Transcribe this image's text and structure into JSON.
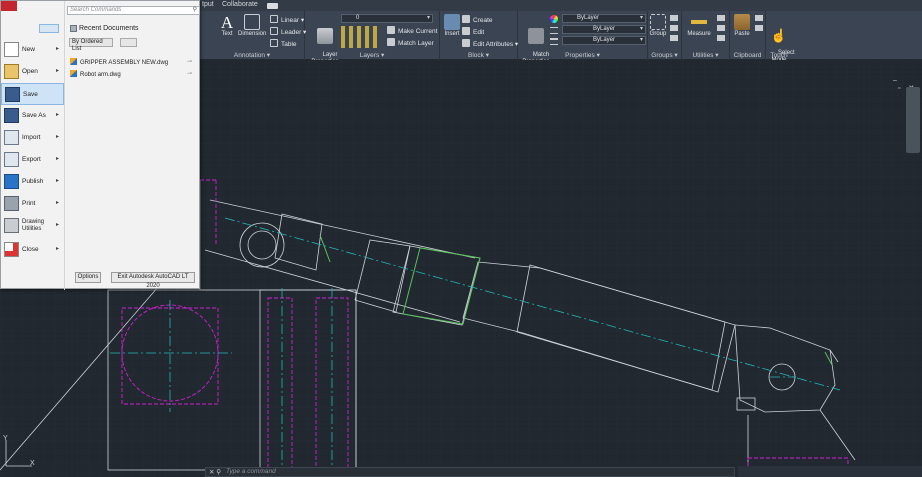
{
  "tabs": {
    "output_partial": "tput",
    "collaborate": "Collaborate"
  },
  "ribbon": {
    "annotation": {
      "title": "Annotation ▾",
      "text": "Text",
      "dimension": "Dimension",
      "linear": "Linear ▾",
      "leader": "Leader ▾",
      "table": "Table"
    },
    "layers": {
      "title": "Layers ▾",
      "layer_properties": "Layer\nProperties",
      "layer_dropdown": "0",
      "make_current": "Make Current",
      "match_layer": "Match Layer"
    },
    "block": {
      "title": "Block ▾",
      "insert": "Insert",
      "create": "Create",
      "edit": "Edit",
      "edit_attributes": "Edit Attributes ▾"
    },
    "properties": {
      "title": "Properties ▾",
      "match_properties": "Match\nProperties",
      "color": "ByLayer",
      "linetype": "ByLayer",
      "lineweight": "ByLayer"
    },
    "groups": {
      "title": "Groups ▾",
      "group": "Group"
    },
    "utilities": {
      "title": "Utilities ▾",
      "measure": "Measure"
    },
    "clipboard": {
      "title": "Clipboard",
      "paste": "Paste"
    },
    "touch": {
      "title": "Touch",
      "select_mode": "Select\nMode"
    }
  },
  "app_menu": {
    "search_placeholder": "Search Commands",
    "items": [
      {
        "label": "New",
        "arrow": "▸"
      },
      {
        "label": "Open",
        "arrow": "▸"
      },
      {
        "label": "Save",
        "arrow": ""
      },
      {
        "label": "Save As",
        "arrow": "▸"
      },
      {
        "label": "Import",
        "arrow": "▸"
      },
      {
        "label": "Export",
        "arrow": "▸"
      },
      {
        "label": "Publish",
        "arrow": "▸"
      },
      {
        "label": "Print",
        "arrow": "▸"
      },
      {
        "label": "Drawing Utilities",
        "arrow": "▸"
      },
      {
        "label": "Close",
        "arrow": "▸"
      }
    ],
    "recent_title": "Recent Documents",
    "order_dropdown": "By Ordered List",
    "documents": [
      {
        "name": "GRIPPER ASSEMBLY NEW.dwg"
      },
      {
        "name": "Robot arm.dwg"
      }
    ],
    "options_button": "Options",
    "exit_button": "Exit Autodesk AutoCAD LT 2020"
  },
  "command_line": {
    "placeholder": "Type a command"
  },
  "colors": {
    "background": "#212830",
    "ribbon": "#3b4452",
    "menu": "#f2f2f2",
    "highlight": "#cfe3f6",
    "magenta": "#d020d0",
    "cyan": "#22b7b7",
    "green": "#57c05a"
  }
}
